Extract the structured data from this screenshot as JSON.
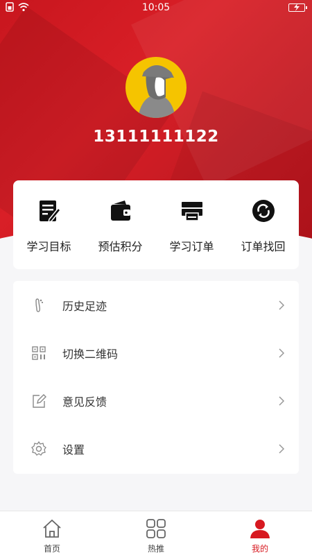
{
  "status_bar": {
    "time": "10:05"
  },
  "profile": {
    "phone": "13111111122"
  },
  "quick_actions": [
    {
      "label": "学习目标",
      "icon": "notepad-pen-icon"
    },
    {
      "label": "预估积分",
      "icon": "wallet-icon"
    },
    {
      "label": "学习订单",
      "icon": "printer-icon"
    },
    {
      "label": "订单找回",
      "icon": "sync-circle-icon"
    }
  ],
  "menu": [
    {
      "label": "历史足迹",
      "icon": "footprint-icon"
    },
    {
      "label": "切换二维码",
      "icon": "qr-code-icon"
    },
    {
      "label": "意见反馈",
      "icon": "edit-icon"
    },
    {
      "label": "设置",
      "icon": "gear-icon"
    }
  ],
  "tabs": [
    {
      "label": "首页",
      "icon": "home-icon",
      "active": false
    },
    {
      "label": "热推",
      "icon": "grid-icon",
      "active": false
    },
    {
      "label": "我的",
      "icon": "user-icon",
      "active": true
    }
  ],
  "colors": {
    "brand_red": "#d71920",
    "header_red": "#c8161e",
    "avatar_yellow": "#f5c400"
  }
}
